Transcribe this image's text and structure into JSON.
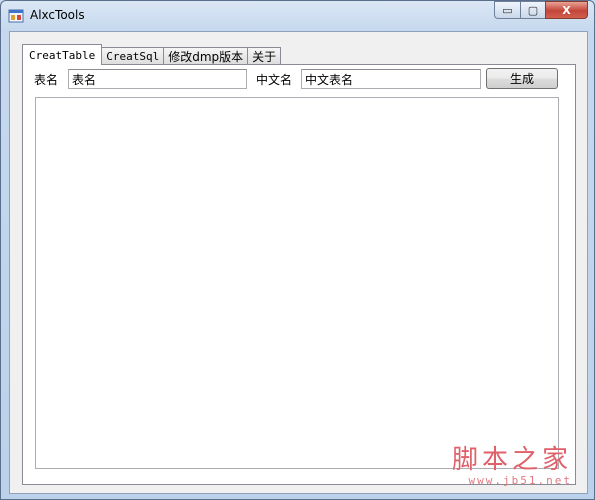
{
  "window": {
    "title": "AlxcTools",
    "controls": {
      "minimize": "▭",
      "maximize": "▢",
      "close": "X"
    }
  },
  "tabs": [
    {
      "label": "CreatTable",
      "active": true
    },
    {
      "label": "CreatSql",
      "active": false
    },
    {
      "label": "修改dmp版本",
      "active": false
    },
    {
      "label": "关于",
      "active": false
    }
  ],
  "form": {
    "table_name_label": "表名",
    "table_name_value": "表名",
    "cn_name_label": "中文名",
    "cn_name_value": "中文表名",
    "generate_button": "生成",
    "output_value": ""
  },
  "watermark": {
    "main": "脚本之家",
    "sub": "www.jb51.net"
  }
}
